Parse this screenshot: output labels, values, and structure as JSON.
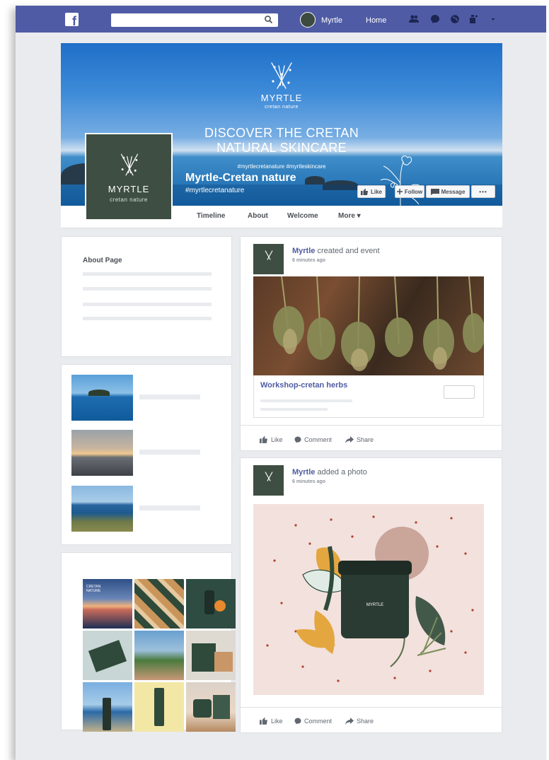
{
  "topbar": {
    "logo": "f",
    "search_placeholder": "",
    "user_name": "Myrtle",
    "home_label": "Home",
    "icons": [
      "friends-icon",
      "messenger-icon",
      "globe-icon",
      "help-icon",
      "dropdown-icon"
    ]
  },
  "cover": {
    "brand": "MYRTLE",
    "brand_sub": "cretan nature",
    "headline_line1": "DISCOVER THE CRETAN",
    "headline_line2": "NATURAL SKINCARE",
    "hashtags": "#myrtlecretanature  #myrtleskincare",
    "page_name": "Myrtle-Cretan nature",
    "page_handle": "#myrtlecretanature",
    "buttons": {
      "like": "Like",
      "follow": "Follow",
      "message": "Message",
      "more": "•••"
    }
  },
  "profile": {
    "brand": "MYRTLE",
    "brand_sub": "cretan nature"
  },
  "nav": {
    "timeline": "Timeline",
    "about": "About",
    "welcome": "Welcome",
    "more": "More ▾"
  },
  "about_card": {
    "title": "About Page"
  },
  "posts": [
    {
      "author": "Myrtle",
      "action": " created and event",
      "time": "6 minutes ago",
      "event_title": "Workshop-cretan herbs"
    },
    {
      "author": "Myrtle",
      "action": " added a photo",
      "time": "6 minutes ago"
    }
  ],
  "post_actions": {
    "like": "Like",
    "comment": "Comment",
    "share": "Share"
  },
  "grid": {
    "first_tile_text": "CRETAN NATURE"
  },
  "colors": {
    "topbar": "#4f5ba4",
    "brand_green": "#3e4e42",
    "link": "#4f5ba4"
  }
}
